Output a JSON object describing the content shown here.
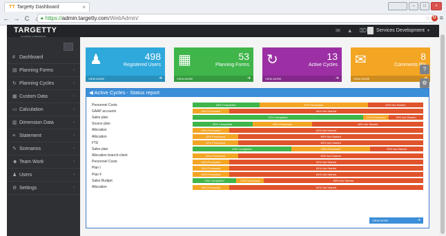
{
  "browser": {
    "tab_title": "Targetty Dashboard",
    "tab_icon": "TT",
    "url_scheme": "https://",
    "url_host": "admin.targetty.com",
    "url_path": "/WebAdmin/"
  },
  "topbar": {
    "logo": "TARGETTY",
    "logo_sub": "PLANNING & BUDGETING",
    "user": "Services Development"
  },
  "sidebar": {
    "items": [
      {
        "label": "Dashboard",
        "icon": "#"
      },
      {
        "label": "Planning Forms",
        "icon": "▤"
      },
      {
        "label": "Planning Cycles",
        "icon": "↻"
      },
      {
        "label": "Custom Data",
        "icon": "▦"
      },
      {
        "label": "Calculation",
        "icon": "▭"
      },
      {
        "label": "Dimension Data",
        "icon": "▥"
      },
      {
        "label": "Statement",
        "icon": "≡"
      },
      {
        "label": "Scenarios",
        "icon": "✎"
      },
      {
        "label": "Team Work",
        "icon": "☻"
      },
      {
        "label": "Users",
        "icon": "♟"
      },
      {
        "label": "Settings",
        "icon": "⚙"
      }
    ]
  },
  "cards": [
    {
      "value": "498",
      "label": "Registered Users",
      "color": "#2fa8dc",
      "icon": "♟",
      "link": "VIEW MORE"
    },
    {
      "value": "53",
      "label": "Planning Forms",
      "color": "#3fb54a",
      "icon": "▦",
      "link": "VIEW MORE"
    },
    {
      "value": "13",
      "label": "Active Cycles",
      "color": "#9b2fa3",
      "icon": "↻",
      "link": "VIEW MORE"
    },
    {
      "value": "8",
      "label": "Comments Pla",
      "color": "#f3a524",
      "icon": "✉",
      "link": "VIEW MORE"
    }
  ],
  "panel": {
    "title": "Active Cycles - Status report",
    "view_more": "VIEW MORE",
    "rows": [
      {
        "name": "Personnel Costs",
        "segments": [
          {
            "c": "green",
            "p": 29,
            "t": "29% Completed"
          },
          {
            "c": "orange",
            "p": 47,
            "t": "47% Processed"
          },
          {
            "c": "red",
            "p": 24,
            "t": "24% Not Started"
          }
        ]
      },
      {
        "name": "GAAP accounts",
        "segments": [
          {
            "c": "orange",
            "p": 16,
            "t": "16% Processed"
          },
          {
            "c": "red",
            "p": 84,
            "t": "84% Not Started"
          }
        ]
      },
      {
        "name": "Sales plan",
        "segments": [
          {
            "c": "green",
            "p": 74,
            "t": "74% Completed"
          },
          {
            "c": "orange",
            "p": 11,
            "t": "11% Processed"
          },
          {
            "c": "red",
            "p": 15,
            "t": "15% Not Started"
          }
        ]
      },
      {
        "name": "Source plan",
        "segments": [
          {
            "c": "green",
            "p": 26,
            "t": "26% Completed"
          },
          {
            "c": "orange",
            "p": 26,
            "t": "26% Processed"
          },
          {
            "c": "red",
            "p": 48,
            "t": "48% Not Started"
          }
        ]
      },
      {
        "name": "Allocation",
        "segments": [
          {
            "c": "orange",
            "p": 16,
            "t": "16% Processed"
          },
          {
            "c": "red",
            "p": 84,
            "t": "84% Not Started"
          }
        ]
      },
      {
        "name": "Allocation",
        "segments": [
          {
            "c": "orange",
            "p": 20,
            "t": "20% Processed"
          },
          {
            "c": "red",
            "p": 80,
            "t": "80% Not Started"
          }
        ]
      },
      {
        "name": "FTE",
        "segments": [
          {
            "c": "orange",
            "p": 20,
            "t": "20% Processed"
          },
          {
            "c": "red",
            "p": 80,
            "t": "80% Not Started"
          }
        ]
      },
      {
        "name": "Sales plan",
        "segments": [
          {
            "c": "green",
            "p": 43,
            "t": "43% Completed"
          },
          {
            "c": "orange",
            "p": 34,
            "t": "34% Processed"
          },
          {
            "c": "red",
            "p": 23,
            "t": "23% Not Started"
          }
        ]
      },
      {
        "name": "Allocation branch-client",
        "segments": [
          {
            "c": "orange",
            "p": 20,
            "t": "20% Processed"
          },
          {
            "c": "red",
            "p": 80,
            "t": "80% Not Started"
          }
        ]
      },
      {
        "name": "Personnel Costs",
        "segments": [
          {
            "c": "orange",
            "p": 16,
            "t": "16% Processed"
          },
          {
            "c": "red",
            "p": 84,
            "t": "84% Not Started"
          }
        ]
      },
      {
        "name": "Plan I",
        "segments": [
          {
            "c": "orange",
            "p": 16,
            "t": "16% Processed"
          },
          {
            "c": "red",
            "p": 84,
            "t": "84% Not Started"
          }
        ]
      },
      {
        "name": "Plan F",
        "segments": [
          {
            "c": "orange",
            "p": 16,
            "t": "16% Processed"
          },
          {
            "c": "red",
            "p": 84,
            "t": "84% Not Started"
          }
        ]
      },
      {
        "name": "Sales Budget",
        "segments": [
          {
            "c": "green",
            "p": 19,
            "t": "19% Completed"
          },
          {
            "c": "orange",
            "p": 12,
            "t": "12% Processed"
          },
          {
            "c": "red",
            "p": 69,
            "t": "69% Not Started"
          }
        ]
      },
      {
        "name": "Allocation",
        "segments": [
          {
            "c": "orange",
            "p": 16,
            "t": "16% Processed"
          },
          {
            "c": "red",
            "p": 84,
            "t": "84% Not Started"
          }
        ]
      }
    ]
  }
}
